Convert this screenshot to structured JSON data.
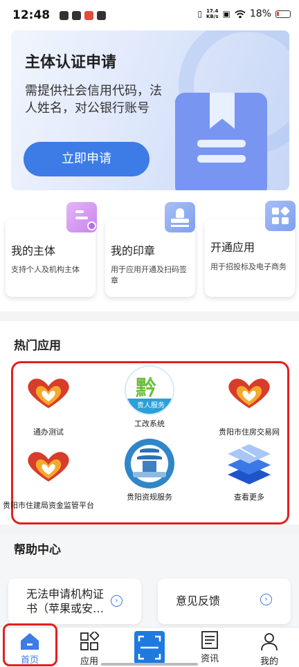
{
  "status_bar": {
    "time": "12:48",
    "net_speed_value": "17.4",
    "net_speed_unit": "KB/s",
    "battery": "18%"
  },
  "banner": {
    "title": "主体认证申请",
    "description": "需提供社会信用代码，法人姓名，对公银行账号",
    "button": "立即申请"
  },
  "cards": [
    {
      "title": "我的主体",
      "desc": "支持个人及机构主体",
      "icon": "id-card-icon"
    },
    {
      "title": "我的印章",
      "desc": "用于应用开通及扫码签章",
      "icon": "seal-icon"
    },
    {
      "title": "开通应用",
      "desc": "用于招投标及电子商务",
      "icon": "apps-grid-icon"
    }
  ],
  "hot_apps": {
    "title": "热门应用",
    "items": [
      {
        "label": "通办测试",
        "icon": "red-heart-logo-icon"
      },
      {
        "label": "工改系统",
        "icon": "gongai-logo-icon",
        "logo_text": "贵人服务"
      },
      {
        "label": "贵阳市住房交易网",
        "icon": "red-heart-logo-icon"
      },
      {
        "label": "贵阳市住建局资金监管平台",
        "icon": "red-heart-logo-icon"
      },
      {
        "label": "贵阳资规服务",
        "icon": "tower-logo-icon"
      },
      {
        "label": "查看更多",
        "icon": "layers-icon"
      }
    ]
  },
  "help": {
    "title": "帮助中心",
    "items": [
      {
        "line1": "无法申请机构证",
        "line2": "书（苹果或安…"
      },
      {
        "line1": "意见反馈"
      }
    ]
  },
  "tabbar": {
    "items": [
      {
        "label": "首页",
        "icon": "home-icon",
        "active": true
      },
      {
        "label": "应用",
        "icon": "apps-icon"
      },
      {
        "label": "",
        "icon": "scan-icon"
      },
      {
        "label": "资讯",
        "icon": "news-icon"
      },
      {
        "label": "我的",
        "icon": "user-icon"
      }
    ]
  },
  "colors": {
    "accent": "#3d7be6",
    "highlight": "#e02020",
    "banner_icon": "#7895f1"
  }
}
